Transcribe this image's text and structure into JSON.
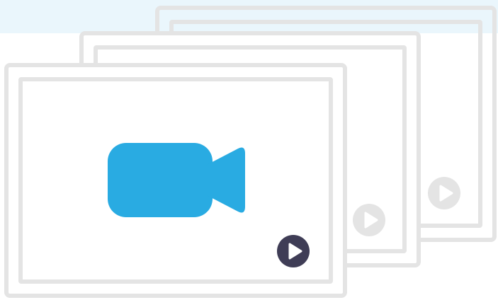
{
  "illustration": {
    "subject": "video-stack",
    "icons": [
      "video-camera-icon",
      "play-icon"
    ],
    "colors": {
      "band": "#eaf6fc",
      "frame": "#e4e4e4",
      "camera": "#29abe2",
      "play_active": "#3f3d56",
      "play_inactive": "#e4e4e4"
    }
  }
}
